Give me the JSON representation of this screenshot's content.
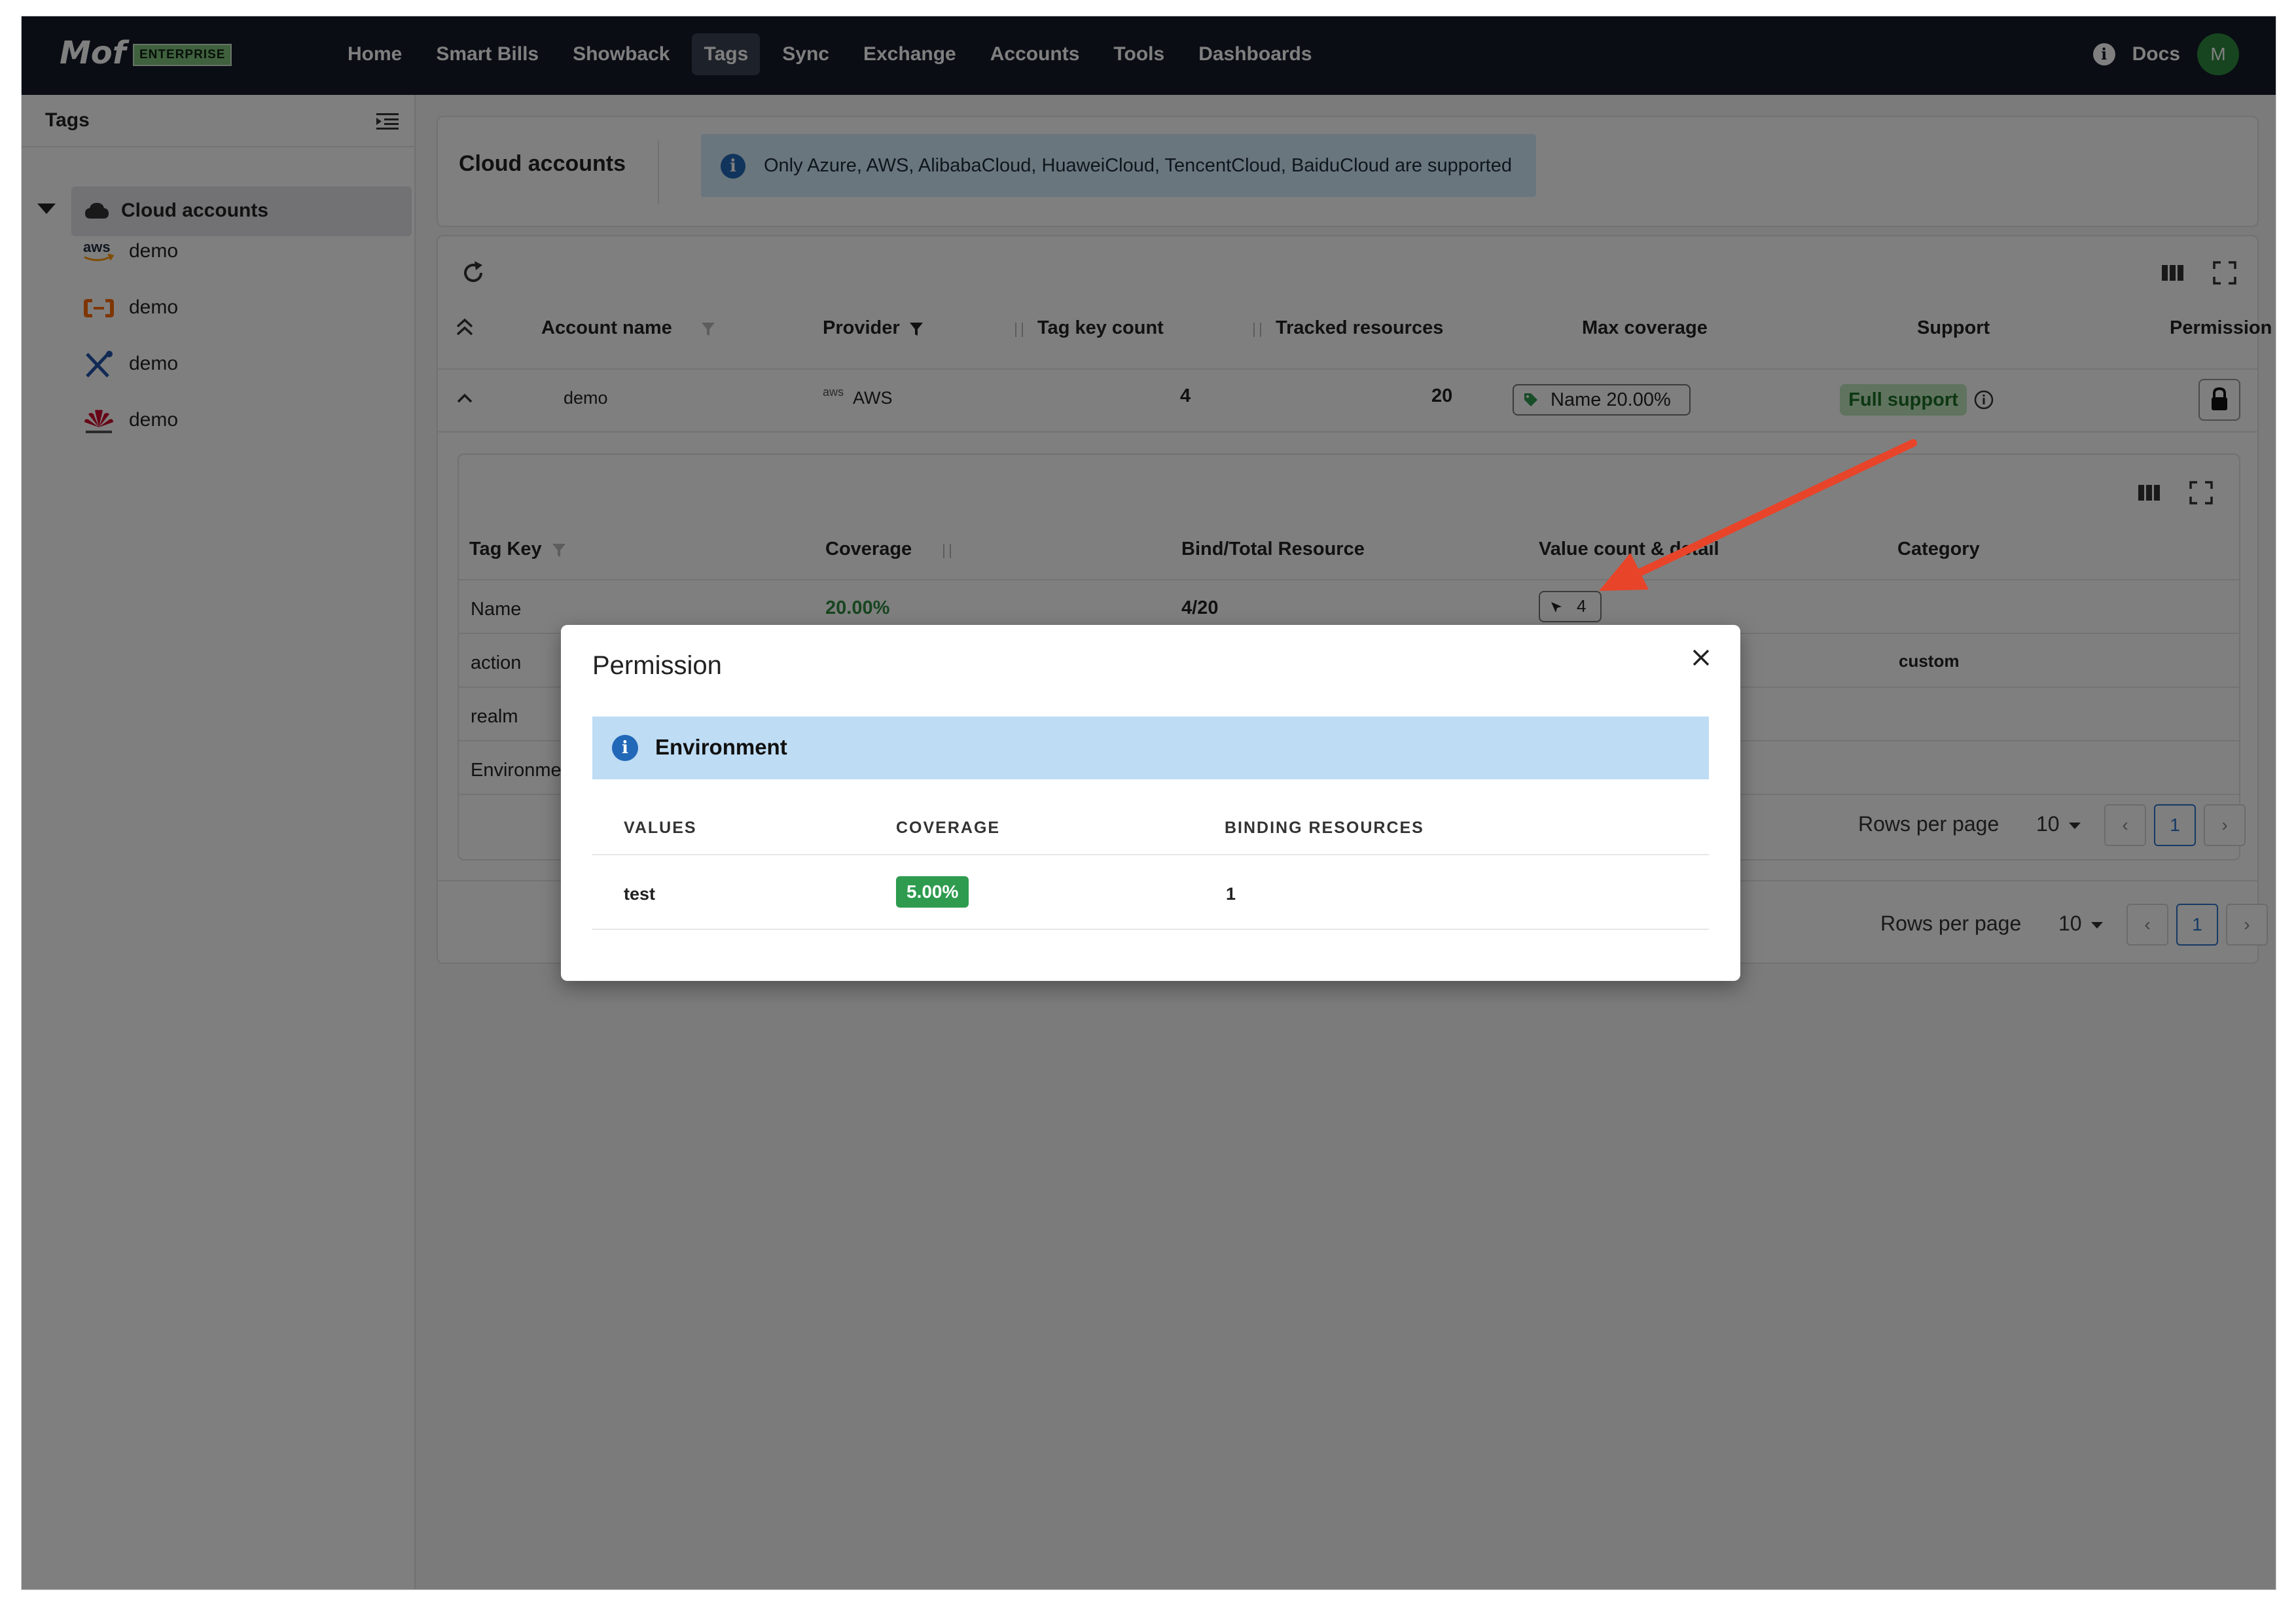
{
  "app": {
    "logo": "Mof",
    "edition": "ENTERPRISE",
    "docs": "Docs",
    "avatar_initial": "M"
  },
  "nav": [
    "Home",
    "Smart Bills",
    "Showback",
    "Tags",
    "Sync",
    "Exchange",
    "Accounts",
    "Tools",
    "Dashboards"
  ],
  "nav_active": "Tags",
  "sidebar": {
    "title": "Tags",
    "group": "Cloud accounts",
    "items": [
      {
        "label": "demo",
        "icon": "aws-icon"
      },
      {
        "label": "demo",
        "icon": "alibabacloud-icon"
      },
      {
        "label": "demo",
        "icon": "tools-icon"
      },
      {
        "label": "demo",
        "icon": "huawei-icon"
      }
    ]
  },
  "cloud_accounts": {
    "title": "Cloud accounts",
    "notice": "Only Azure, AWS, AlibabaCloud, HuaweiCloud, TencentCloud, BaiduCloud are supported"
  },
  "accounts_table": {
    "headers": [
      "Account name",
      "Provider",
      "Tag key count",
      "Tracked resources",
      "Max coverage",
      "Support",
      "Permission"
    ],
    "row": {
      "account": "demo",
      "provider": "AWS",
      "provider_icon_text": "aws",
      "tag_key_count": "4",
      "tracked_resources": "20",
      "max_coverage": "Name 20.00%",
      "support": "Full support"
    },
    "pager": {
      "rows_label": "Rows per page",
      "rows_value": "10",
      "page": "1"
    }
  },
  "tags_table": {
    "headers": [
      "Tag Key",
      "Coverage",
      "Bind/Total Resource",
      "Value count & detail",
      "Category"
    ],
    "rows": [
      {
        "key": "Name",
        "coverage": "20.00%",
        "bind": "4/20",
        "value_count": "4",
        "category": ""
      },
      {
        "key": "action",
        "category": "custom"
      },
      {
        "key": "realm"
      },
      {
        "key": "Environment"
      }
    ],
    "pager": {
      "rows_label": "Rows per page",
      "rows_value": "10",
      "page": "1"
    }
  },
  "modal": {
    "title": "Permission",
    "banner": "Environment",
    "headers": [
      "VALUES",
      "COVERAGE",
      "BINDING RESOURCES"
    ],
    "rows": [
      {
        "value": "test",
        "coverage": "5.00%",
        "binding": "1"
      }
    ]
  },
  "colors": {
    "topbar": "#151a29",
    "accent_green": "#2e9b4f",
    "info_blue": "#2268b8",
    "annotation_arrow": "#e8442a"
  }
}
